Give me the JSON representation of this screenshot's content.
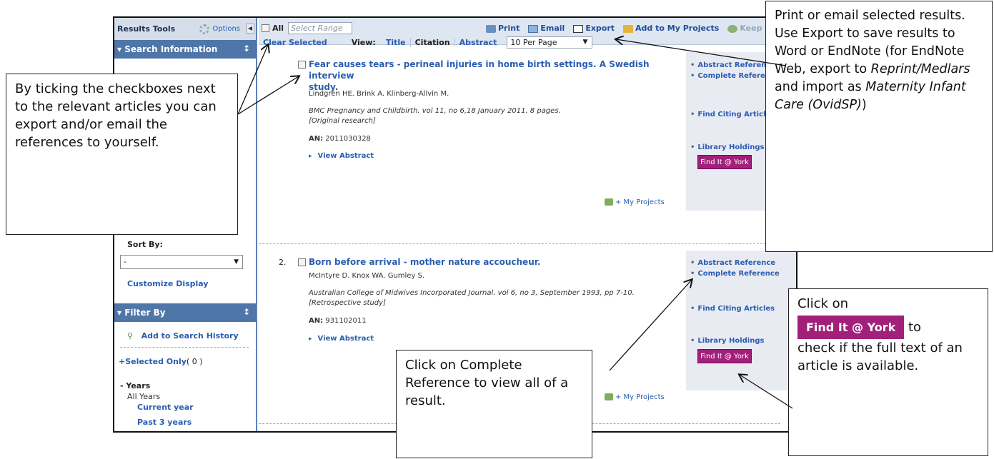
{
  "sidebar": {
    "results_tools": "Results Tools",
    "options": "Options",
    "search_info": "Search Information",
    "sort_by_label": "Sort By:",
    "sort_value": "-",
    "customize": "Customize Display",
    "filter_by": "Filter By",
    "add_history": "Add to Search History",
    "selected_only": "+Selected Only",
    "selected_count": "( 0 )",
    "years_head": "- Years",
    "all_years": "All Years",
    "current_year": "Current year",
    "past_3": "Past 3 years"
  },
  "toolbar": {
    "all_label": "All",
    "range_placeholder": "Select Range",
    "print": "Print",
    "email": "Email",
    "export": "Export",
    "add_projects": "Add to My Projects",
    "keep": "Keep Sele",
    "clear": "Clear Selected",
    "view_label": "View:",
    "view_title": "Title",
    "view_citation": "Citation",
    "view_abstract": "Abstract",
    "per_page": "10 Per Page"
  },
  "results": [
    {
      "title_line1": "Fear causes tears - perineal injuries in home birth settings. A Swedish interview",
      "title_line2": "study.",
      "authors": "Lindgren HE. Brink A. Klinberg-Allvin M.",
      "source_line1": "BMC Pregnancy and Childbirth. vol 11, no 6,18 January 2011. 8 pages.",
      "source_line2": "[Original research]",
      "an_label": "AN:",
      "an": "2011030328",
      "view_abstract": "View Abstract",
      "my_projects": "+ My Projects",
      "links": [
        "Abstract Reference",
        "Complete Reference",
        "Find Citing Articles",
        "Library Holdings"
      ],
      "findit": "Find It @ York"
    },
    {
      "number": "2.",
      "title_line1": "Born before arrival - mother nature accoucheur.",
      "authors": "McIntyre D. Knox WA. Gumley S.",
      "source_line1": "Australian College of Midwives Incorporated Journal. vol 6, no 3, September 1993, pp 7-10.",
      "source_line2": "[Retrospective study]",
      "an_label": "AN:",
      "an": "931102011",
      "view_abstract": "View Abstract",
      "my_projects": "+ My Projects",
      "links": [
        "Abstract Reference",
        "Complete Reference",
        "Find Citing Articles",
        "Library Holdings"
      ],
      "findit": "Find It @ York"
    }
  ],
  "callouts": {
    "checkbox": "By ticking the checkboxes next to the relevant articles you can export and/or email the references to yourself.",
    "export_p1": "Print",
    "export_p2": " or ",
    "export_p3": "email",
    "export_p4": " selected results. Use ",
    "export_p5": "Export",
    "export_p6": " to save results to Word or EndNote (for EndNote Web, export to ",
    "export_p7": "Reprint/Medlars",
    "export_p8": " and import as ",
    "export_p9": "Maternity Infant Care (OvidSP)",
    "export_p10": ")",
    "complete_p1": "Click on ",
    "complete_p2": "Complete Reference",
    "complete_p3": " to view all of a result.",
    "findit_p1": "Click on",
    "findit_btn": "Find It @ York",
    "findit_p2": " to",
    "findit_p3": "check if the full text of an article is available."
  }
}
